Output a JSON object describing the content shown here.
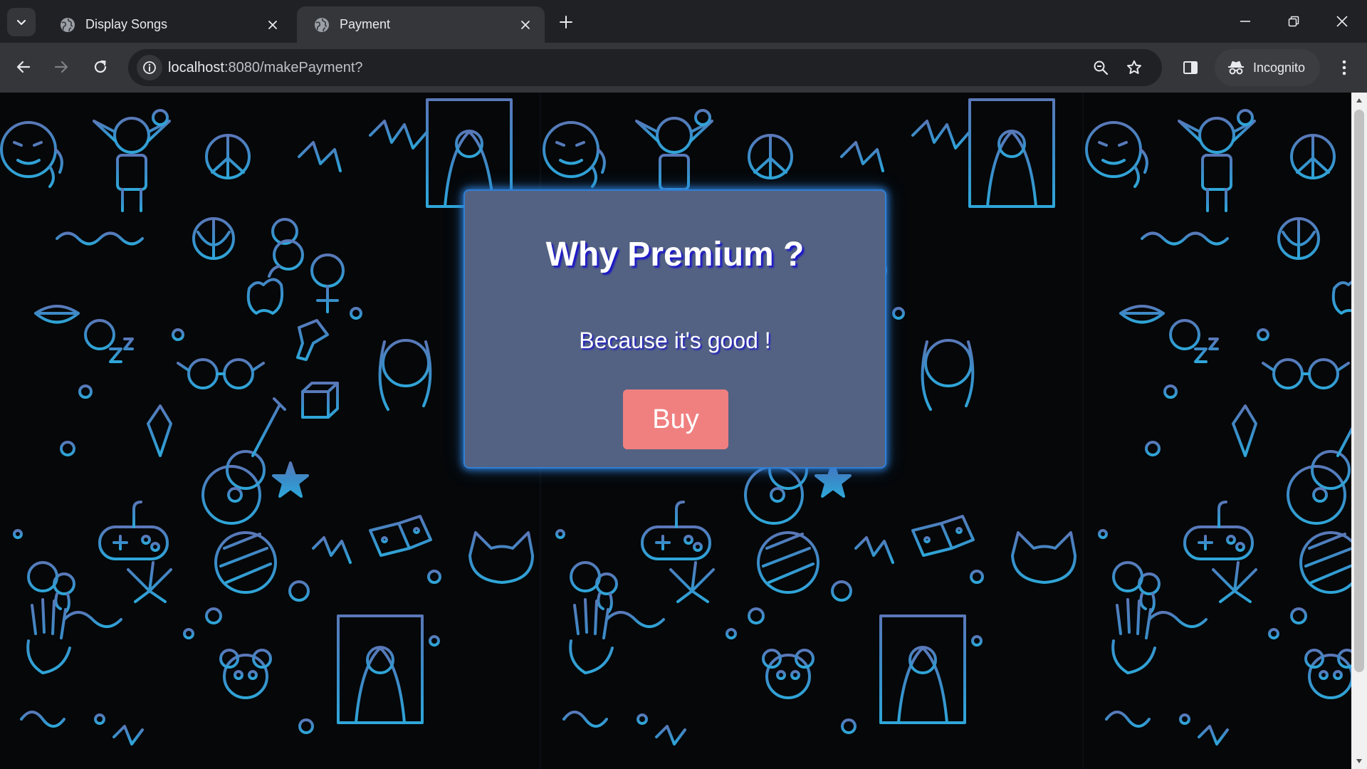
{
  "browser": {
    "tabs": [
      {
        "title": "Display Songs",
        "active": false
      },
      {
        "title": "Payment",
        "active": true
      }
    ],
    "address_bar": {
      "host": "localhost",
      "path": ":8080/makePayment?"
    },
    "profile_label": "Incognito"
  },
  "page": {
    "card": {
      "title": "Why Premium ?",
      "text": "Because it's good !",
      "button_label": "Buy"
    }
  },
  "colors": {
    "card_background": "#536282",
    "card_border": "#2f7fd6",
    "button_background": "#f08080",
    "text_shadow": "#1d18c8",
    "doodle_color": "#3d9ad1"
  }
}
